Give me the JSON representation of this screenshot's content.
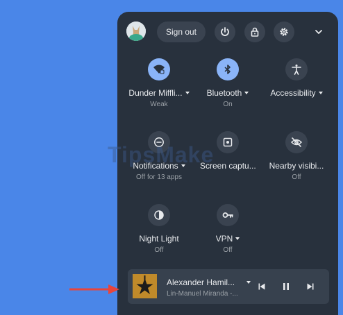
{
  "header": {
    "signout_label": "Sign out",
    "icons": [
      "avatar",
      "power-icon",
      "lock-icon",
      "gear-icon",
      "chevron-down-icon"
    ]
  },
  "tiles": [
    {
      "label": "Dunder Miffli...",
      "sub": "Weak",
      "icon": "wifi-icon",
      "active": true,
      "dropdown": true
    },
    {
      "label": "Bluetooth",
      "sub": "On",
      "icon": "bluetooth-icon",
      "active": true,
      "dropdown": true
    },
    {
      "label": "Accessibility",
      "sub": "",
      "icon": "accessibility-icon",
      "active": false,
      "dropdown": true
    },
    {
      "label": "Notifications",
      "sub": "Off for 13 apps",
      "icon": "notifications-off-icon",
      "active": false,
      "dropdown": true
    },
    {
      "label": "Screen captu...",
      "sub": "",
      "icon": "screen-capture-icon",
      "active": false,
      "dropdown": false
    },
    {
      "label": "Nearby visibi...",
      "sub": "Off",
      "icon": "nearby-visibility-icon",
      "active": false,
      "dropdown": false
    },
    {
      "label": "Night Light",
      "sub": "Off",
      "icon": "night-light-icon",
      "active": false,
      "dropdown": false
    },
    {
      "label": "VPN",
      "sub": "Off",
      "icon": "vpn-key-icon",
      "active": false,
      "dropdown": true
    }
  ],
  "media": {
    "title": "Alexander Hamil...",
    "artist": "Lin-Manuel Miranda -..."
  },
  "watermark": "TipsMake",
  "colors": {
    "background": "#4a86e8",
    "panel": "#28313d",
    "accent": "#8ab4f8",
    "arrow": "#e8453c"
  }
}
